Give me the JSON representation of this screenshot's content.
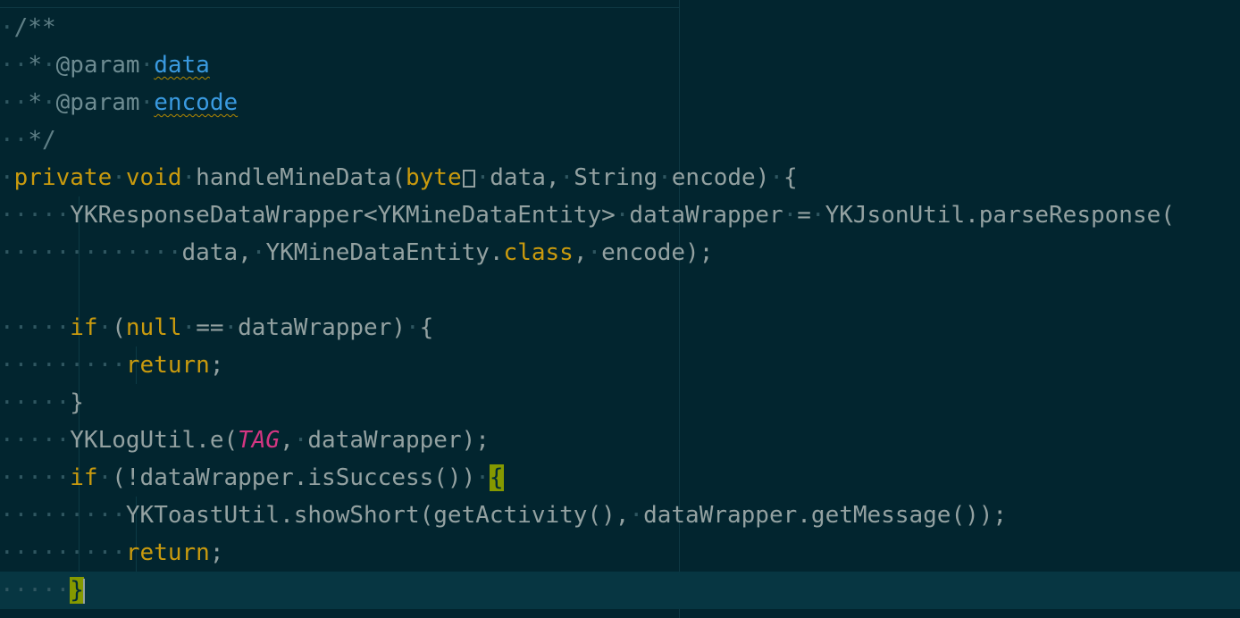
{
  "code_lines": [
    {
      "tokens": [
        {
          "t": "·",
          "c": "ws"
        },
        {
          "t": "/**",
          "c": "cm"
        }
      ]
    },
    {
      "tokens": [
        {
          "t": "··",
          "c": "ws"
        },
        {
          "t": "*",
          "c": "cm"
        },
        {
          "t": "·",
          "c": "ws"
        },
        {
          "t": "@param",
          "c": "tag-ann"
        },
        {
          "t": "·",
          "c": "ws"
        },
        {
          "t": "data",
          "c": "cm-link"
        }
      ]
    },
    {
      "tokens": [
        {
          "t": "··",
          "c": "ws"
        },
        {
          "t": "*",
          "c": "cm"
        },
        {
          "t": "·",
          "c": "ws"
        },
        {
          "t": "@param",
          "c": "tag-ann"
        },
        {
          "t": "·",
          "c": "ws"
        },
        {
          "t": "encode",
          "c": "cm-link"
        }
      ]
    },
    {
      "tokens": [
        {
          "t": "··",
          "c": "ws"
        },
        {
          "t": "*/",
          "c": "cm"
        }
      ]
    },
    {
      "tokens": [
        {
          "t": "·",
          "c": "ws"
        },
        {
          "t": "private",
          "c": "kw"
        },
        {
          "t": "·",
          "c": "ws"
        },
        {
          "t": "void",
          "c": "kw"
        },
        {
          "t": "·",
          "c": "ws"
        },
        {
          "t": "handleMineData(",
          "c": "id"
        },
        {
          "t": "byte",
          "c": "kw"
        },
        {
          "t": "[]",
          "c": "arr"
        },
        {
          "t": "·",
          "c": "ws"
        },
        {
          "t": "data,",
          "c": "id"
        },
        {
          "t": "·",
          "c": "ws"
        },
        {
          "t": "String",
          "c": "id"
        },
        {
          "t": "·",
          "c": "ws"
        },
        {
          "t": "encode)",
          "c": "id"
        },
        {
          "t": "·",
          "c": "ws"
        },
        {
          "t": "{",
          "c": "id"
        }
      ]
    },
    {
      "tokens": [
        {
          "t": "·····",
          "c": "ws"
        },
        {
          "t": "YKResponseDataWrapper<YKMineDataEntity>",
          "c": "id"
        },
        {
          "t": "·",
          "c": "ws"
        },
        {
          "t": "dataWrapper",
          "c": "id"
        },
        {
          "t": "·",
          "c": "ws"
        },
        {
          "t": "=",
          "c": "id"
        },
        {
          "t": "·",
          "c": "ws"
        },
        {
          "t": "YKJsonUtil.parseResponse(",
          "c": "id"
        }
      ]
    },
    {
      "tokens": [
        {
          "t": "·············",
          "c": "ws"
        },
        {
          "t": "data,",
          "c": "id"
        },
        {
          "t": "·",
          "c": "ws"
        },
        {
          "t": "YKMineDataEntity.",
          "c": "id"
        },
        {
          "t": "class",
          "c": "kw"
        },
        {
          "t": ",",
          "c": "id"
        },
        {
          "t": "·",
          "c": "ws"
        },
        {
          "t": "encode);",
          "c": "id"
        }
      ]
    },
    {
      "tokens": []
    },
    {
      "tokens": [
        {
          "t": "·····",
          "c": "ws"
        },
        {
          "t": "if",
          "c": "kw"
        },
        {
          "t": "·",
          "c": "ws"
        },
        {
          "t": "(",
          "c": "id"
        },
        {
          "t": "null",
          "c": "kw"
        },
        {
          "t": "·",
          "c": "ws"
        },
        {
          "t": "==",
          "c": "id"
        },
        {
          "t": "·",
          "c": "ws"
        },
        {
          "t": "dataWrapper)",
          "c": "id"
        },
        {
          "t": "·",
          "c": "ws"
        },
        {
          "t": "{",
          "c": "id"
        }
      ]
    },
    {
      "tokens": [
        {
          "t": "·········",
          "c": "ws"
        },
        {
          "t": "return",
          "c": "kw"
        },
        {
          "t": ";",
          "c": "id"
        }
      ]
    },
    {
      "tokens": [
        {
          "t": "·····",
          "c": "ws"
        },
        {
          "t": "}",
          "c": "id"
        }
      ]
    },
    {
      "tokens": [
        {
          "t": "·····",
          "c": "ws"
        },
        {
          "t": "YKLogUtil.e(",
          "c": "id"
        },
        {
          "t": "TAG",
          "c": "tg"
        },
        {
          "t": ",",
          "c": "id"
        },
        {
          "t": "·",
          "c": "ws"
        },
        {
          "t": "dataWrapper);",
          "c": "id"
        }
      ]
    },
    {
      "tokens": [
        {
          "t": "·····",
          "c": "ws"
        },
        {
          "t": "if",
          "c": "kw"
        },
        {
          "t": "·",
          "c": "ws"
        },
        {
          "t": "(!dataWrapper.isSuccess())",
          "c": "id"
        },
        {
          "t": "·",
          "c": "ws"
        },
        {
          "t": "{",
          "c": "br-hl"
        }
      ]
    },
    {
      "tokens": [
        {
          "t": "·········",
          "c": "ws"
        },
        {
          "t": "YKToastUtil.showShort(getActivity(),",
          "c": "id"
        },
        {
          "t": "·",
          "c": "ws"
        },
        {
          "t": "dataWrapper.getMessage());",
          "c": "id"
        }
      ]
    },
    {
      "tokens": [
        {
          "t": "·········",
          "c": "ws"
        },
        {
          "t": "return",
          "c": "kw"
        },
        {
          "t": ";",
          "c": "id"
        }
      ]
    },
    {
      "tokens": [
        {
          "t": "·····",
          "c": "ws"
        },
        {
          "t": "}",
          "c": "br-hl"
        },
        {
          "t": "",
          "c": "caret"
        }
      ]
    }
  ],
  "colors": {
    "background": "#02252f",
    "current_line": "#073642",
    "keyword": "#c99a0e",
    "identifier": "#93a1a1",
    "comment": "#5f7f86",
    "link": "#3a9ae0",
    "constant": "#d33682",
    "bracket_match": "#859900"
  }
}
